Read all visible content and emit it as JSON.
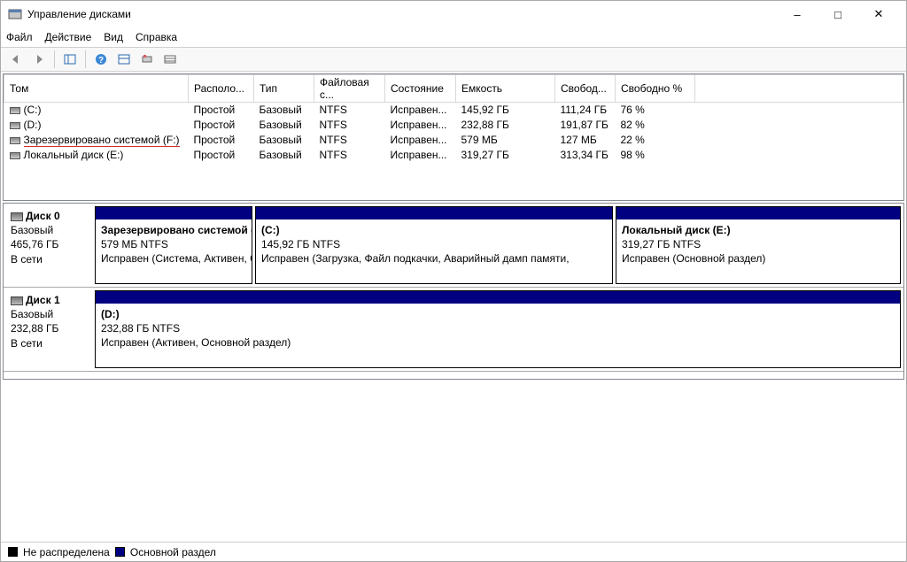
{
  "window": {
    "title": "Управление дисками"
  },
  "menu": {
    "file": "Файл",
    "action": "Действие",
    "view": "Вид",
    "help": "Справка"
  },
  "columns": {
    "c0": "Том",
    "c1": "Располо...",
    "c2": "Тип",
    "c3": "Файловая с...",
    "c4": "Состояние",
    "c5": "Емкость",
    "c6": "Свобод...",
    "c7": "Свободно %"
  },
  "volumes": [
    {
      "name": "(C:)",
      "layout": "Простой",
      "type": "Базовый",
      "fs": "NTFS",
      "status": "Исправен...",
      "capacity": "145,92 ГБ",
      "free": "111,24 ГБ",
      "freepct": "76 %",
      "underline": false
    },
    {
      "name": "(D:)",
      "layout": "Простой",
      "type": "Базовый",
      "fs": "NTFS",
      "status": "Исправен...",
      "capacity": "232,88 ГБ",
      "free": "191,87 ГБ",
      "freepct": "82 %",
      "underline": false
    },
    {
      "name": "Зарезервировано системой (F:)",
      "layout": "Простой",
      "type": "Базовый",
      "fs": "NTFS",
      "status": "Исправен...",
      "capacity": "579 МБ",
      "free": "127 МБ",
      "freepct": "22 %",
      "underline": true
    },
    {
      "name": "Локальный диск (E:)",
      "layout": "Простой",
      "type": "Базовый",
      "fs": "NTFS",
      "status": "Исправен...",
      "capacity": "319,27 ГБ",
      "free": "313,34 ГБ",
      "freepct": "98 %",
      "underline": false
    }
  ],
  "disks": [
    {
      "name": "Диск 0",
      "type": "Базовый",
      "size": "465,76 ГБ",
      "status": "В сети",
      "parts": [
        {
          "title": "Зарезервировано системой  (F",
          "sub": "579 МБ NTFS",
          "state": "Исправен (Система, Активен, О",
          "flex": "0 0 178px"
        },
        {
          "title": "(C:)",
          "sub": "145,92 ГБ NTFS",
          "state": "Исправен (Загрузка, Файл подкачки, Аварийный дамп памяти,",
          "flex": "1 1 350px"
        },
        {
          "title": "Локальный диск  (E:)",
          "sub": "319,27 ГБ NTFS",
          "state": "Исправен (Основной раздел)",
          "flex": "0 0 322px"
        }
      ]
    },
    {
      "name": "Диск 1",
      "type": "Базовый",
      "size": "232,88 ГБ",
      "status": "В сети",
      "parts": [
        {
          "title": "(D:)",
          "sub": "232,88 ГБ NTFS",
          "state": "Исправен (Активен, Основной раздел)",
          "flex": "1 1 auto"
        }
      ]
    }
  ],
  "legend": {
    "unalloc": "Не распределена",
    "primary": "Основной раздел"
  }
}
